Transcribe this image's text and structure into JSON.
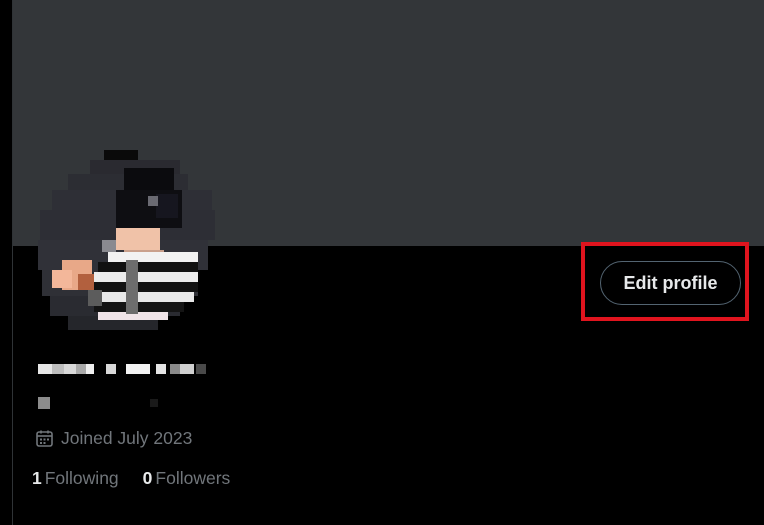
{
  "profile": {
    "edit_button_label": "Edit profile",
    "joined_text": "Joined July 2023",
    "following": {
      "count": "1",
      "label": "Following"
    },
    "followers": {
      "count": "0",
      "label": "Followers"
    }
  },
  "colors": {
    "banner": "#333639",
    "background": "#000000",
    "highlight": "#e0141e",
    "muted_text": "#71767b",
    "primary_text": "#e7e9ea"
  },
  "icons": {
    "joined": "calendar-icon"
  }
}
